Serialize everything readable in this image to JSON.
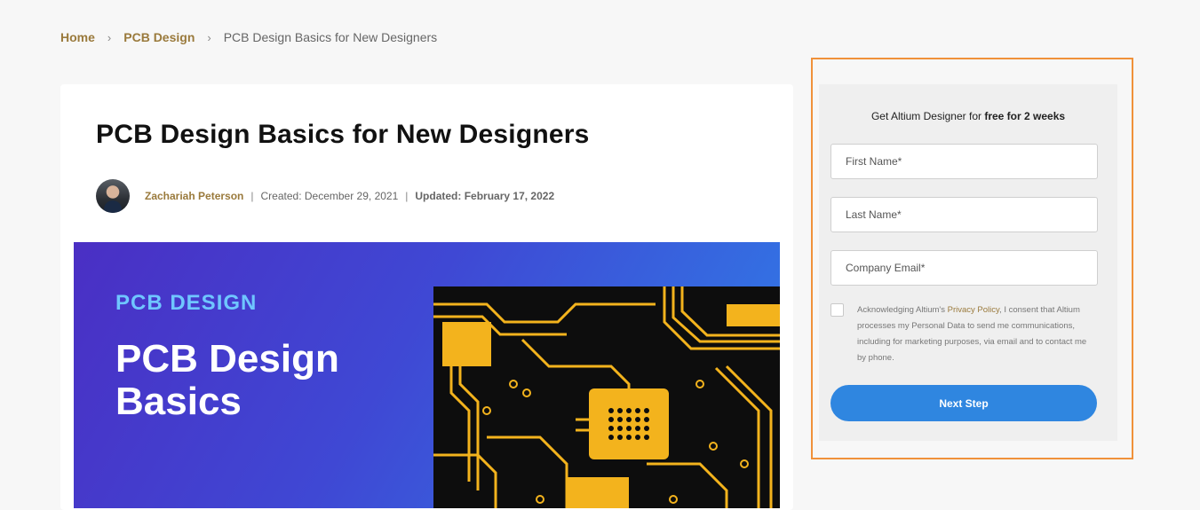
{
  "breadcrumb": {
    "items": [
      "Home",
      "PCB Design"
    ],
    "current": "PCB Design Basics for New Designers",
    "separator": "›"
  },
  "article": {
    "title": "PCB Design Basics for New Designers",
    "author": "Zachariah Peterson",
    "separator": "|",
    "created_label": "Created: December 29, 2021",
    "updated_label": "Updated: February 17, 2022",
    "hero": {
      "eyebrow": "PCB DESIGN",
      "title_line1": "PCB Design",
      "title_line2": "Basics"
    }
  },
  "form": {
    "heading_prefix": "Get Altium Designer for ",
    "heading_bold": "free for 2 weeks",
    "first_name_placeholder": "First Name*",
    "last_name_placeholder": "Last Name*",
    "email_placeholder": "Company Email*",
    "consent_prefix": "Acknowledging Altium's ",
    "consent_link": "Privacy Policy",
    "consent_suffix": ", I consent that Altium processes my Personal Data to send me communications, including for marketing purposes, via email and to contact me by phone.",
    "submit_label": "Next Step"
  },
  "colors": {
    "accent_link": "#9a7a3c",
    "button_blue": "#2f86e0",
    "highlight_orange": "#f0913a"
  }
}
